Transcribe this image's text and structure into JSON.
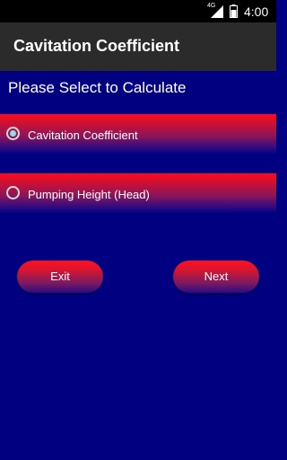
{
  "status_bar": {
    "network": "4G",
    "time": "4:00",
    "icons": [
      "signal-icon",
      "battery-icon"
    ]
  },
  "action_bar": {
    "title": "Cavitation Coefficient"
  },
  "prompt": "Please Select to Calculate",
  "options": [
    {
      "label": "Cavitation Coefficient",
      "checked": true
    },
    {
      "label": "Pumping Height (Head)",
      "checked": false
    }
  ],
  "buttons": {
    "exit": "Exit",
    "next": "Next"
  },
  "colors": {
    "background": "#000080",
    "action_bar": "#2b2b2b",
    "accent_red": "#ff0a1a",
    "radio_selected": "#8fdbe6"
  }
}
